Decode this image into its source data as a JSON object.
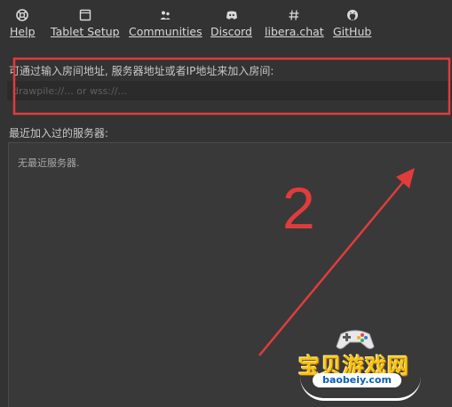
{
  "toolbar": {
    "items": [
      {
        "label": "Help",
        "icon": "lifebuoy-icon"
      },
      {
        "label": "Tablet Setup",
        "icon": "tablet-icon"
      },
      {
        "label": "Communities",
        "icon": "people-icon"
      },
      {
        "label": "Discord",
        "icon": "discord-icon"
      },
      {
        "label": "libera.chat",
        "icon": "hash-icon"
      },
      {
        "label": "GitHub",
        "icon": "github-icon"
      }
    ]
  },
  "join": {
    "prompt": "可通过输入房间地址, 服务器地址或者IP地址来加入房间:",
    "address_value": "",
    "address_placeholder": "drawpile://... or wss://..."
  },
  "recent": {
    "label": "最近加入过的服务器:",
    "empty_text": "无最近服务器."
  },
  "annotation": {
    "step_number": "2",
    "color": "#e03c3c"
  },
  "watermark": {
    "title": "宝贝游戏网",
    "url": "baobeiy.com"
  }
}
